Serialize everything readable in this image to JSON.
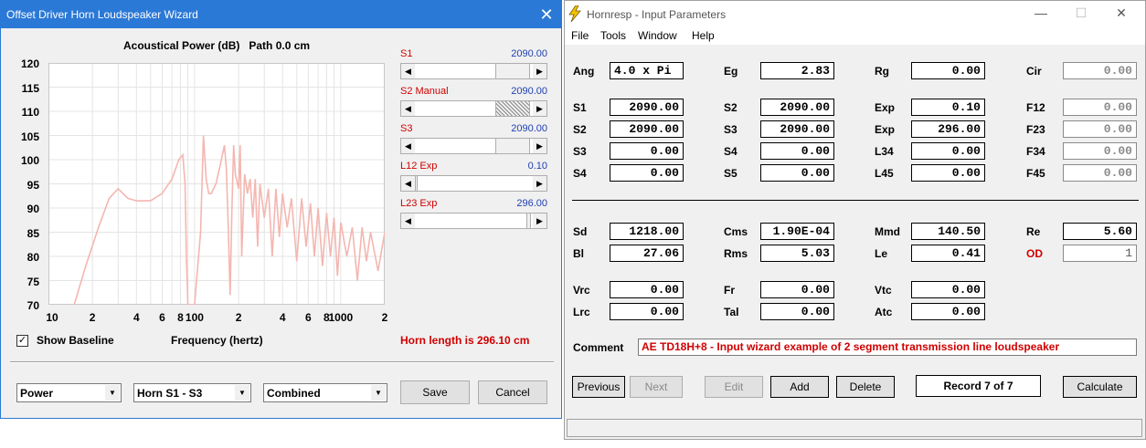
{
  "wizard": {
    "title": "Offset Driver Horn Loudspeaker Wizard",
    "graph_title": "Acoustical Power (dB)   Path 0.0 cm",
    "y_ticks": [
      "120",
      "115",
      "110",
      "105",
      "100",
      "95",
      "90",
      "85",
      "80",
      "75",
      "70"
    ],
    "x_ticks": [
      "10",
      "2",
      "4",
      "6",
      "8",
      "100",
      "2",
      "4",
      "6",
      "8",
      "1000",
      "2"
    ],
    "sliders": [
      {
        "label": "S1",
        "value": "2090.00"
      },
      {
        "label": "S2  Manual",
        "value": "2090.00"
      },
      {
        "label": "S3",
        "value": "2090.00"
      },
      {
        "label": "L12  Exp",
        "value": "0.10"
      },
      {
        "label": "L23  Exp",
        "value": "296.00"
      }
    ],
    "show_baseline_label": "Show Baseline",
    "show_baseline_checked": "✓",
    "frequency_label": "Frequency (hertz)",
    "horn_length": "Horn length is 296.10 cm",
    "dropdowns": {
      "power": "Power",
      "horn": "Horn S1 - S3",
      "mode": "Combined"
    },
    "save_label": "Save",
    "cancel_label": "Cancel",
    "curve_color": "#f4b6b0"
  },
  "chart_data": {
    "type": "line",
    "title": "Acoustical Power (dB)   Path 0.0 cm",
    "xlabel": "Frequency (hertz)",
    "ylabel": "",
    "x_scale": "log",
    "xlim": [
      10,
      2000
    ],
    "ylim": [
      70,
      120
    ],
    "grid": true,
    "series": [
      {
        "x": [
          15,
          18,
          22,
          26,
          30,
          35,
          40,
          50,
          60,
          70,
          78,
          83,
          86,
          88,
          90,
          95,
          100,
          110,
          115,
          120,
          125,
          130,
          140,
          150,
          160,
          165,
          170,
          175,
          180,
          185,
          190,
          200,
          205,
          210,
          220,
          230,
          240,
          250,
          260,
          270,
          280,
          300,
          320,
          340,
          360,
          380,
          400,
          430,
          460,
          500,
          540,
          580,
          620,
          660,
          700,
          750,
          800,
          850,
          900,
          950,
          1000,
          1100,
          1200,
          1300,
          1400,
          1500,
          1600,
          1800,
          2000
        ],
        "y": [
          70,
          78,
          86,
          92,
          94,
          92,
          91.5,
          91.5,
          93,
          96,
          100,
          101,
          95,
          80,
          70,
          70,
          70,
          85,
          105,
          96,
          93,
          93,
          95,
          99,
          103,
          98,
          86,
          72,
          90,
          103,
          97,
          94,
          103,
          80,
          97,
          93,
          96,
          88,
          96,
          82,
          95,
          88,
          94,
          80,
          94,
          84,
          93,
          86,
          92,
          79,
          92,
          82,
          91,
          80,
          90,
          78,
          89,
          80,
          88,
          76,
          87,
          80,
          86,
          75,
          86,
          79,
          85,
          77,
          85
        ]
      }
    ]
  },
  "hornresp": {
    "title": "Hornresp - Input Parameters",
    "window_controls": [
      "—",
      "☐",
      "✕"
    ],
    "menu": [
      "File",
      "Tools",
      "Window",
      "Help"
    ],
    "params": [
      {
        "label": "Ang",
        "value": "4.0 x Pi",
        "kind": "left"
      },
      {
        "label": "Eg",
        "value": "2.83"
      },
      {
        "label": "Rg",
        "value": "0.00"
      },
      {
        "label": "Cir",
        "value": "0.00",
        "kind": "dis"
      },
      {
        "label": "S1",
        "value": "2090.00"
      },
      {
        "label": "S2",
        "value": "2090.00"
      },
      {
        "label": "Exp",
        "value": "0.10"
      },
      {
        "label": "F12",
        "value": "0.00",
        "kind": "dis"
      },
      {
        "label": "S2",
        "value": "2090.00"
      },
      {
        "label": "S3",
        "value": "2090.00"
      },
      {
        "label": "Exp",
        "value": "296.00"
      },
      {
        "label": "F23",
        "value": "0.00",
        "kind": "dis"
      },
      {
        "label": "S3",
        "value": "0.00"
      },
      {
        "label": "S4",
        "value": "0.00"
      },
      {
        "label": "L34",
        "value": "0.00"
      },
      {
        "label": "F34",
        "value": "0.00",
        "kind": "dis"
      },
      {
        "label": "S4",
        "value": "0.00"
      },
      {
        "label": "S5",
        "value": "0.00"
      },
      {
        "label": "L45",
        "value": "0.00"
      },
      {
        "label": "F45",
        "value": "0.00",
        "kind": "dis"
      },
      {
        "label": "Sd",
        "value": "1218.00"
      },
      {
        "label": "Cms",
        "value": "1.90E-04"
      },
      {
        "label": "Mmd",
        "value": "140.50"
      },
      {
        "label": "Re",
        "value": "5.60"
      },
      {
        "label": "Bl",
        "value": "27.06"
      },
      {
        "label": "Rms",
        "value": "5.03"
      },
      {
        "label": "Le",
        "value": "0.41"
      },
      {
        "label": "OD",
        "value": "1",
        "kind": "od"
      },
      {
        "label": "Vrc",
        "value": "0.00"
      },
      {
        "label": "Fr",
        "value": "0.00"
      },
      {
        "label": "Vtc",
        "value": "0.00"
      },
      {
        "label": "Lrc",
        "value": "0.00"
      },
      {
        "label": "Tal",
        "value": "0.00"
      },
      {
        "label": "Atc",
        "value": "0.00"
      }
    ],
    "comment_label": "Comment",
    "comment": "AE TD18H+8 - Input wizard example of 2 segment transmission line loudspeaker",
    "buttons": {
      "previous": "Previous",
      "next": "Next",
      "edit": "Edit",
      "add": "Add",
      "delete": "Delete",
      "calculate": "Calculate"
    },
    "record": "Record 7 of 7",
    "od_color": "#d00000"
  }
}
